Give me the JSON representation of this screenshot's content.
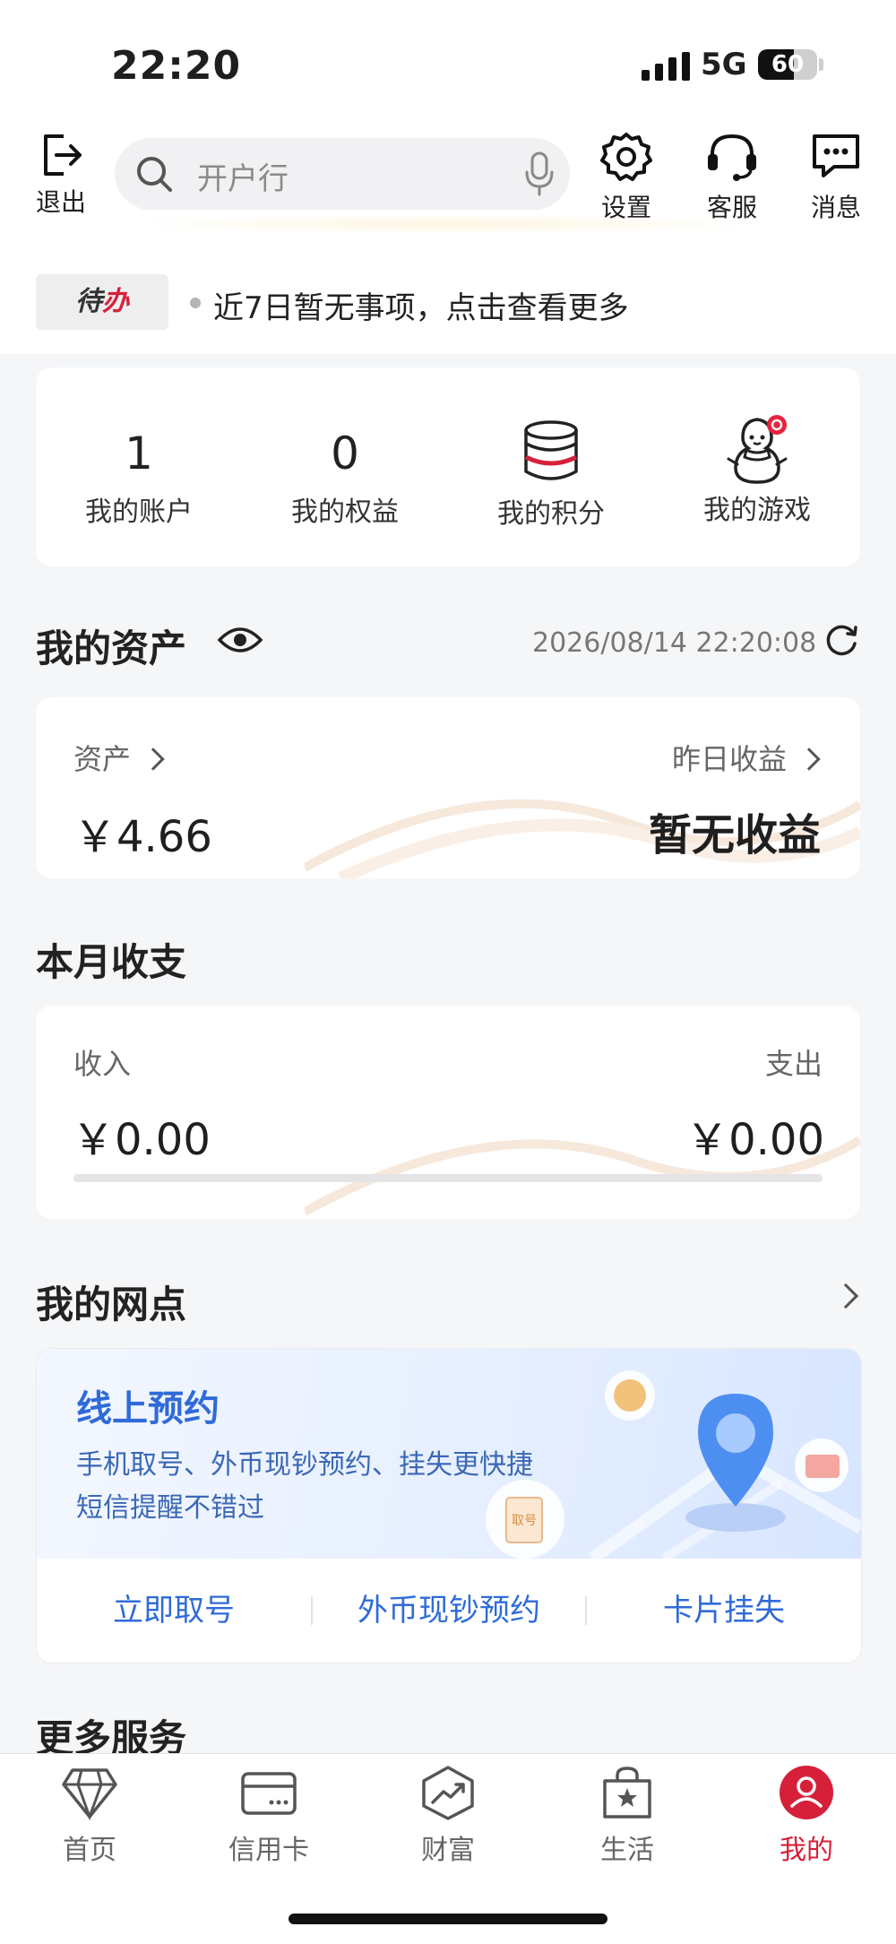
{
  "status_bar": {
    "time": "22:20",
    "network": "5G",
    "battery": "60",
    "battery_level": 0.6
  },
  "header": {
    "logout_label": "退出",
    "search_placeholder": "开户行",
    "settings_label": "设置",
    "service_label": "客服",
    "messages_label": "消息"
  },
  "todo": {
    "badge_prefix": "待",
    "badge_suffix": "办",
    "text": "近7日暂无事项，点击查看更多"
  },
  "quick_stats": {
    "accounts": {
      "value": "1",
      "label": "我的账户"
    },
    "rights": {
      "value": "0",
      "label": "我的权益"
    },
    "points": {
      "label": "我的积分"
    },
    "games": {
      "label": "我的游戏"
    }
  },
  "assets": {
    "title": "我的资产",
    "timestamp": "2026/08/14 22:20:08",
    "asset_label": "资产",
    "asset_value": "￥4.66",
    "yesterday_label": "昨日收益",
    "yesterday_value": "暂无收益"
  },
  "monthly": {
    "title": "本月收支",
    "income_label": "收入",
    "income_value": "￥0.00",
    "expense_label": "支出",
    "expense_value": "￥0.00",
    "ratio": 0
  },
  "branch": {
    "title": "我的网点",
    "banner_title": "线上预约",
    "banner_line1": "手机取号、外币现钞预约、挂失更快捷",
    "banner_line2": "短信提醒不错过",
    "ticket_text": "取号",
    "links": [
      "立即取号",
      "外币现钞预约",
      "卡片挂失"
    ]
  },
  "more_services": {
    "title": "更多服务"
  },
  "tabbar": {
    "tabs": [
      {
        "label": "首页",
        "icon": "diamond-icon"
      },
      {
        "label": "信用卡",
        "icon": "credit-card-icon"
      },
      {
        "label": "财富",
        "icon": "wealth-chart-icon"
      },
      {
        "label": "生活",
        "icon": "shopping-bag-star-icon"
      },
      {
        "label": "我的",
        "icon": "user-profile-icon"
      }
    ],
    "active_index": 4
  },
  "colors": {
    "brand_red": "#d6203a",
    "link_blue": "#2f6bd8",
    "background": "#f5f6f8"
  }
}
